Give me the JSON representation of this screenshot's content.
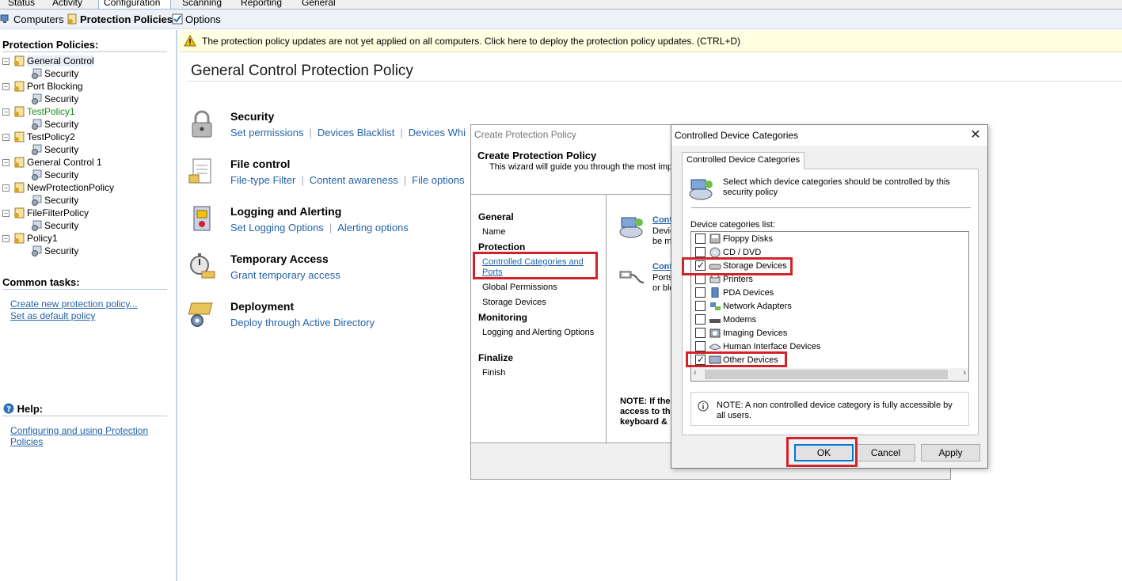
{
  "top_tabs": [
    "Status",
    "Activity",
    "Configuration",
    "Scanning",
    "Reporting",
    "General"
  ],
  "subbar": {
    "computers": "Computers",
    "protection_policies": "Protection Policies",
    "options": "Options"
  },
  "left": {
    "policies_heading": "Protection Policies:",
    "tree": [
      {
        "label": "General Control",
        "child": "Security"
      },
      {
        "label": "Port Blocking",
        "child": "Security"
      },
      {
        "label": "TestPolicy1",
        "child": "Security"
      },
      {
        "label": "TestPolicy2",
        "child": "Security"
      },
      {
        "label": "General Control 1",
        "child": "Security"
      },
      {
        "label": "NewProtectionPolicy",
        "child": "Security"
      },
      {
        "label": "FileFilterPolicy",
        "child": "Security"
      },
      {
        "label": "Policy1",
        "child": "Security"
      }
    ],
    "common_tasks_heading": "Common tasks:",
    "tasks": [
      "Create new protection policy...",
      "Set as default policy"
    ],
    "help_heading": "Help:",
    "help_link": "Configuring and using Protection Policies"
  },
  "warning": "The protection policy updates are not yet applied on all computers. Click here to deploy the protection policy updates. (CTRL+D)",
  "main_title": "General Control Protection Policy",
  "sections": [
    {
      "title": "Security",
      "links": [
        "Set permissions",
        "Devices Blacklist",
        "Devices Whi"
      ]
    },
    {
      "title": "File control",
      "links": [
        "File-type Filter",
        "Content awareness",
        "File options"
      ]
    },
    {
      "title": "Logging and Alerting",
      "links": [
        "Set Logging Options",
        "Alerting options"
      ]
    },
    {
      "title": "Temporary Access",
      "links": [
        "Grant temporary access"
      ]
    },
    {
      "title": "Deployment",
      "links": [
        "Deploy through Active Directory"
      ]
    }
  ],
  "wizard": {
    "window_title": "Create Protection Policy",
    "heading": "Create Protection Policy",
    "subheading": "This wizard will guide you through the most impo",
    "nav": {
      "general": "General",
      "name": "Name",
      "protection": "Protection",
      "controlled": "Controlled Categories and Ports",
      "global": "Global Permissions",
      "storage": "Storage Devices",
      "monitoring": "Monitoring",
      "logging": "Logging and Alerting Options",
      "finalize": "Finalize",
      "finish": "Finish"
    },
    "content": {
      "item1_link": "Conti",
      "item1_text1": "Devic",
      "item1_text2": "be mi",
      "item2_link": "Conti",
      "item2_text1": "Ports",
      "item2_text2": "or blo",
      "note1": "NOTE: If the",
      "note2": "access to th",
      "note3": "keyboard &"
    }
  },
  "dialog": {
    "title": "Controlled Device Categories",
    "tab": "Controlled Device Categories",
    "description": "Select which device categories should be controlled by this security policy",
    "list_label": "Device categories list:",
    "categories": [
      {
        "label": "Floppy Disks",
        "checked": false
      },
      {
        "label": "CD / DVD",
        "checked": false
      },
      {
        "label": "Storage Devices",
        "checked": true
      },
      {
        "label": "Printers",
        "checked": false
      },
      {
        "label": "PDA Devices",
        "checked": false
      },
      {
        "label": "Network Adapters",
        "checked": false
      },
      {
        "label": "Modems",
        "checked": false
      },
      {
        "label": "Imaging Devices",
        "checked": false
      },
      {
        "label": "Human Interface Devices",
        "checked": false
      },
      {
        "label": "Other Devices",
        "checked": true
      }
    ],
    "note": "NOTE: A non controlled device category is fully accessible by all users.",
    "ok": "OK",
    "cancel": "Cancel",
    "apply": "Apply",
    "close_glyph": "✕"
  },
  "colors": {
    "link": "#2462a8",
    "highlight_box": "#d1232a",
    "warning_bg": "#ffffe1",
    "green_policy": "#1f8a1f"
  }
}
